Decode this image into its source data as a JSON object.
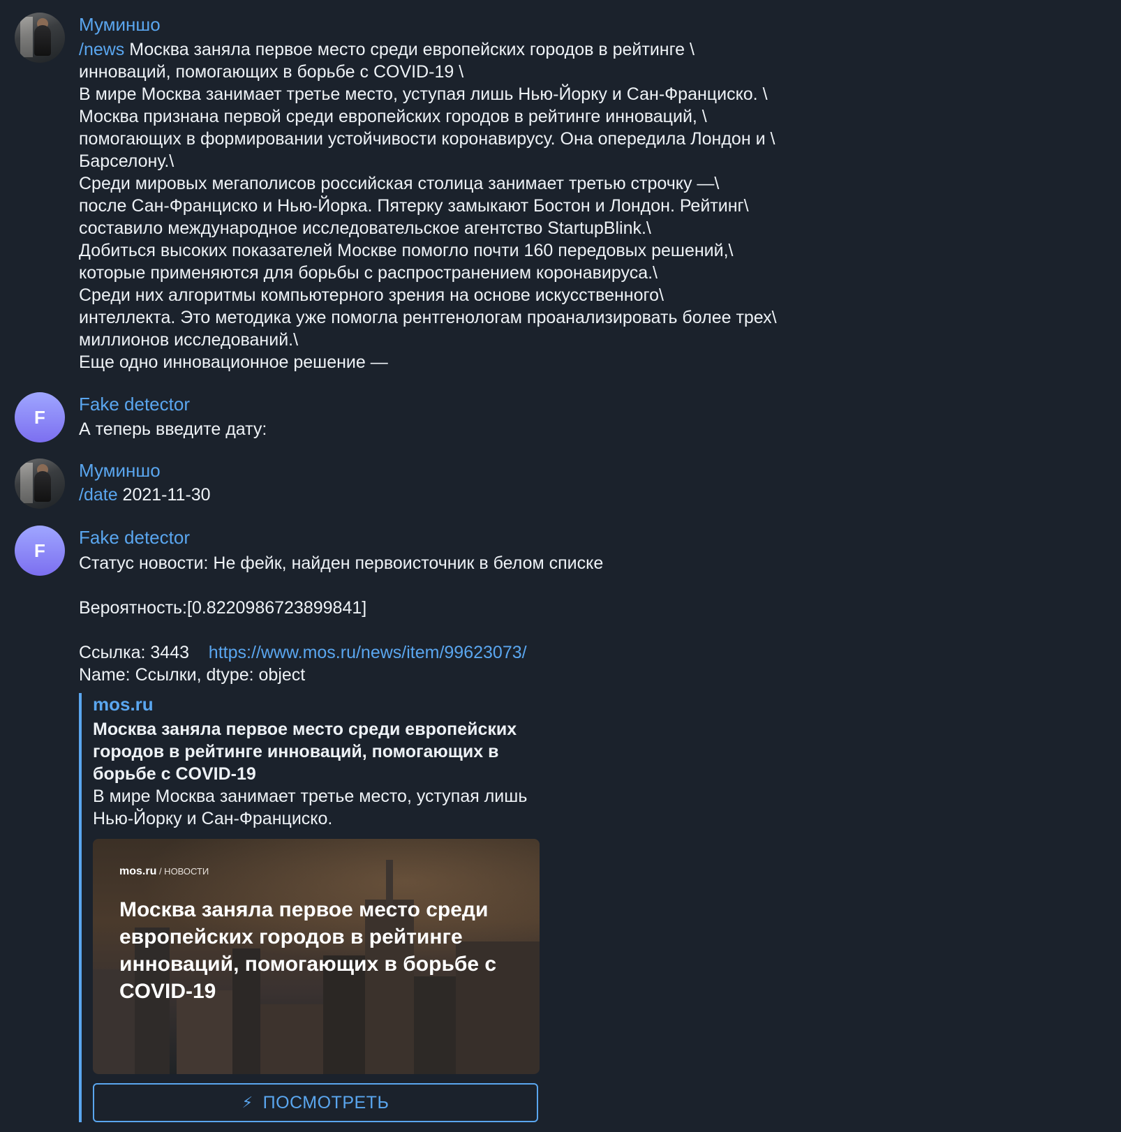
{
  "messages": [
    {
      "sender": "Муминшо",
      "command": "/news",
      "lines": [
        " Москва заняла первое место среди европейских городов в рейтинге \\",
        "инноваций, помогающих в борьбе с COVID-19 \\",
        "В мире Москва занимает третье место, уступая лишь Нью-Йорку и Сан-Франциско. \\",
        "Москва признана первой среди европейских городов в рейтинге инноваций, \\",
        "помогающих в формировании устойчивости коронавирусу. Она опередила Лондон и \\",
        "Барселону.\\",
        "Среди мировых мегаполисов российская столица занимает третью строчку —\\",
        "после Сан-Франциско и Нью-Йорка. Пятерку замыкают Бостон и Лондон. Рейтинг\\",
        "составило международное исследовательское агентство StartupBlink.\\",
        "Добиться высоких показателей Москве помогло почти 160 передовых решений,\\",
        "которые применяются для борьбы с распространением коронавируса.\\",
        "Среди них алгоритмы компьютерного зрения на основе искусственного\\",
        "интеллекта. Это методика уже помогла рентгенологам проанализировать более трех\\",
        "миллионов исследований.\\",
        "Еще одно инновационное решение —"
      ]
    },
    {
      "sender": "Fake detector",
      "avatar_letter": "F",
      "text": "А теперь введите дату:"
    },
    {
      "sender": "Муминшо",
      "command": "/date",
      "text": " 2021-11-30"
    },
    {
      "sender": "Fake detector",
      "avatar_letter": "F",
      "status": "Статус новости: Не фейк, найден первоисточник в белом списке",
      "probability": "Вероятность:[0.8220986723899841]",
      "link_prefix": "Ссылка: 3443    ",
      "link_url": "https://www.mos.ru/news/item/99623073/",
      "name_line": "Name: Ссылки, dtype: object",
      "preview": {
        "site": "mos.ru",
        "title": "Москва заняла первое место среди европейских городов в рейтинге инноваций, помогающих в борьбе с COVID-19",
        "description": "В мире Москва занимает третье место, уступая лишь Нью-Йорку и Сан-Франциско.",
        "image_logo": "mos.ru",
        "image_section": " / НОВОСТИ",
        "image_title": "Москва заняла первое место среди европейских городов в рейтинге инноваций, помогающих в борьбе с COVID-19",
        "button_label": "ПОСМОТРЕТЬ"
      }
    }
  ],
  "colors": {
    "background": "#1b222c",
    "accent": "#5aa6ef",
    "text": "#eef2f6"
  }
}
